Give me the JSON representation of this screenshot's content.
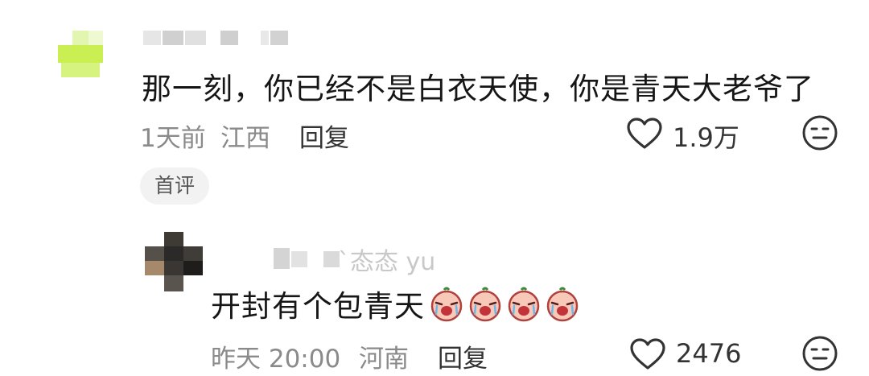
{
  "comment": {
    "text": "那一刻，你已经不是白衣天使，你是青天大老爷了",
    "time": "1天前",
    "location": "江西",
    "reply_label": "回复",
    "likes": "1.9万",
    "badge": "首评"
  },
  "reply": {
    "username_visible": "ˋ态态 yu",
    "text": "开封有个包青天",
    "emoji_count": 4,
    "time": "昨天 20:00",
    "location": "河南",
    "reply_label": "回复",
    "likes": "2476"
  },
  "icons": {
    "like": "heart-outline-icon",
    "dislike": "neutral-face-icon",
    "emoji": "crying-face-sticker-icon"
  },
  "colors": {
    "avatar_main": "#c8ee4a",
    "text": "#161616",
    "meta": "#8a8a8a"
  }
}
